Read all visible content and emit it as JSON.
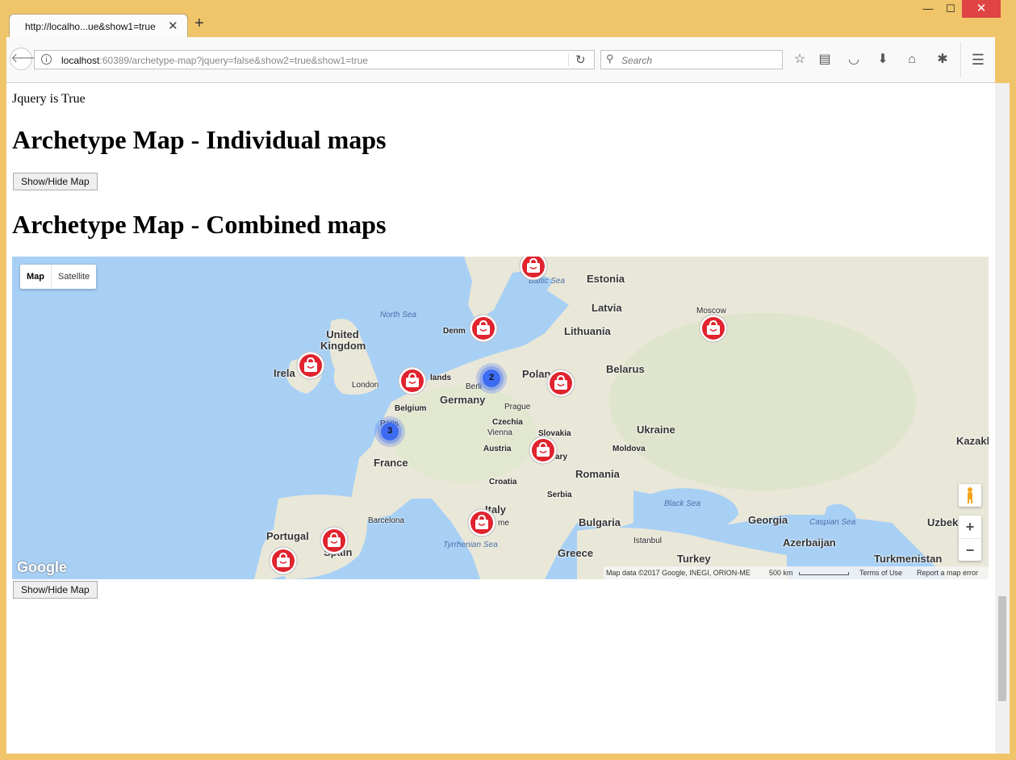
{
  "browser": {
    "tab_title": "http://localho...ue&show1=true",
    "url_host": "localhost",
    "url_rest": ":60389/archetype-map?jquery=false&show2=true&show1=true",
    "search_placeholder": "Search",
    "window": {
      "minimize": "—",
      "maximize": "☐",
      "close": "✕"
    }
  },
  "page": {
    "jquery_status": "Jquery is True",
    "heading_individual": "Archetype Map - Individual maps",
    "heading_combined": "Archetype Map - Combined maps",
    "show_hide_label": "Show/Hide Map"
  },
  "map": {
    "type_map": "Map",
    "type_satellite": "Satellite",
    "zoom_in": "+",
    "zoom_out": "−",
    "google_logo": "Google",
    "attribution": "Map data ©2017 Google, INEGI, ORION-ME",
    "scale": "500 km",
    "terms": "Terms of Use",
    "report": "Report a map error",
    "labels": {
      "estonia": "Estonia",
      "latvia": "Latvia",
      "lithuania": "Lithuania",
      "moscow": "Moscow",
      "belarus": "Belarus",
      "united_kingdom": "United Kingdom",
      "ireland": "Irela",
      "london": "London",
      "netherlands": "lands",
      "denmark": "Denm",
      "berlin": "Berli",
      "poland": "Polan",
      "germany": "Germany",
      "belgium": "Belgium",
      "prague": "Prague",
      "czechia": "Czechia",
      "vienna": "Vienna",
      "slovakia": "Slovakia",
      "austria": "Austria",
      "hungary": "ary",
      "ukraine": "Ukraine",
      "moldova": "Moldova",
      "kazakh": "Kazakh",
      "france": "France",
      "paris": "Paris",
      "croatia": "Croatia",
      "romania": "Romania",
      "serbia": "Serbia",
      "italy": "Italy",
      "rome": "me",
      "bulgaria": "Bulgaria",
      "georgia": "Georgia",
      "uzbek": "Uzbek",
      "portugal": "Portugal",
      "spain": "Spain",
      "barcelona": "Barcelona",
      "istanbul": "Istanbul",
      "azerbaijan": "Azerbaijan",
      "greece": "Greece",
      "turkey": "Turkey",
      "turkmenistan": "Turkmenistan",
      "north_sea": "North Sea",
      "baltic_sea": "Baltic Sea",
      "black_sea": "Black Sea",
      "caspian_sea": "Caspian Sea",
      "tyrrhenian_sea": "Tyrrhenian Sea"
    },
    "clusters": [
      {
        "count": "2"
      },
      {
        "count": "3"
      }
    ],
    "colors": {
      "marker": "#e0232e",
      "cluster": "#3d6cf2",
      "water": "#a8d0f5",
      "land": "#e9e7d8"
    }
  }
}
